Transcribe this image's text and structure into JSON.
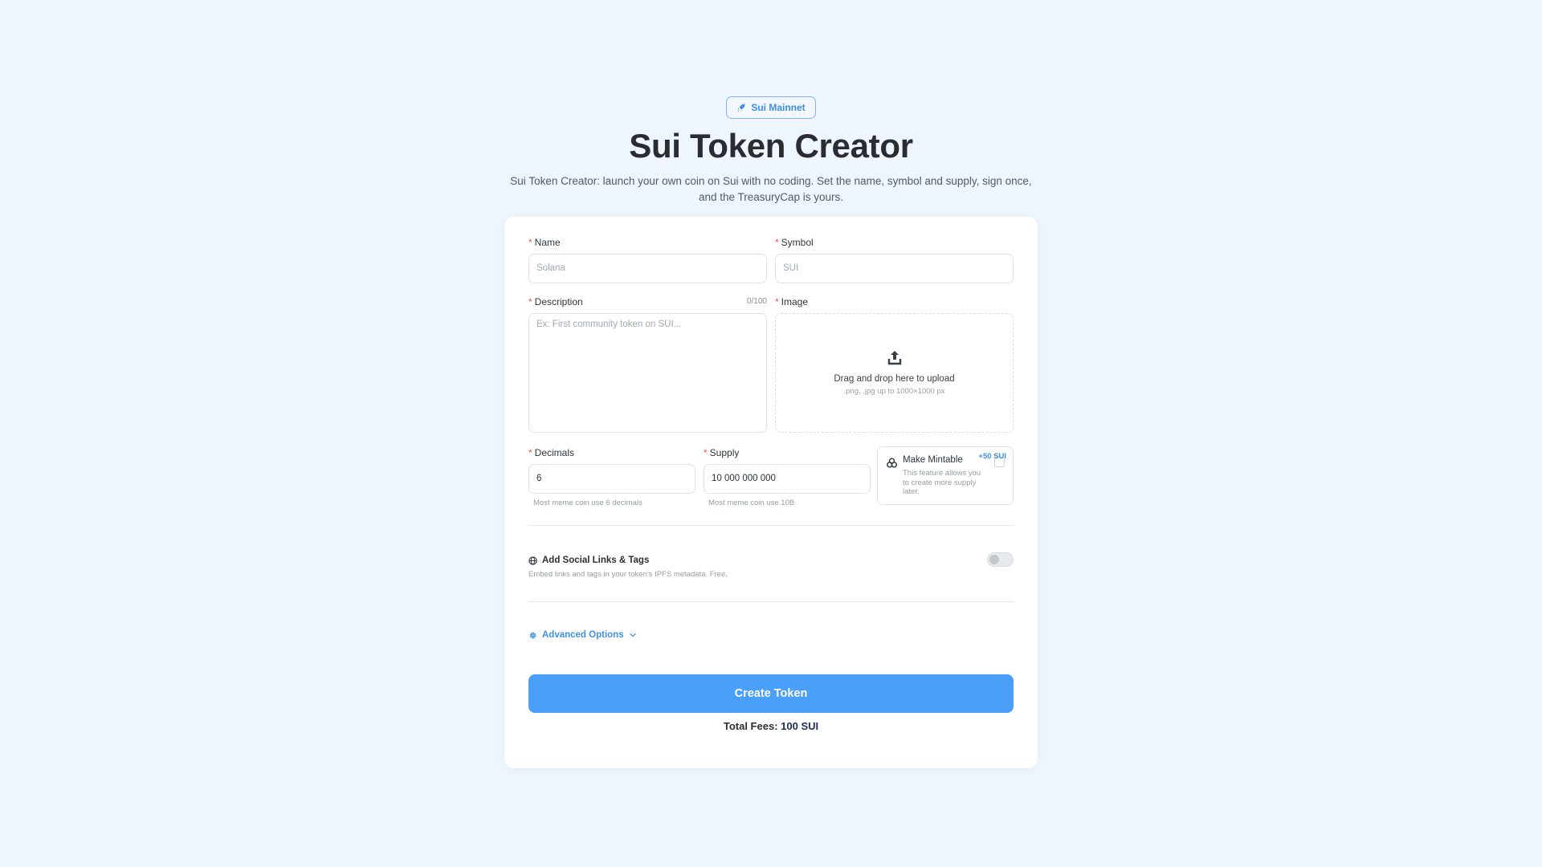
{
  "header": {
    "network_badge": "Sui Mainnet",
    "title": "Sui Token Creator",
    "subtitle": "Sui Token Creator: launch your own coin on Sui with no coding. Set the name, symbol and supply, sign once, and the TreasuryCap is yours."
  },
  "form": {
    "name": {
      "label": "Name",
      "placeholder": "Solana"
    },
    "symbol": {
      "label": "Symbol",
      "placeholder": "SUI"
    },
    "description": {
      "label": "Description",
      "counter": "0/100",
      "placeholder": "Ex: First community token on SUI..."
    },
    "image": {
      "label": "Image",
      "drop_text": "Drag and drop here to upload",
      "hint": ".png, .jpg up to 1000×1000 px"
    },
    "decimals": {
      "label": "Decimals",
      "value": "6",
      "help": "Most meme coin use 6 decimals"
    },
    "supply": {
      "label": "Supply",
      "value": "10 000 000 000",
      "help": "Most meme coin use 10B"
    },
    "mintable": {
      "title": "Make Mintable",
      "fee": "+50 SUI",
      "description": "This feature allows you to create more supply later.",
      "checked": false
    },
    "social": {
      "title": "Add Social Links & Tags",
      "description": "Embed links and tags in your token's IPFS metadata. Free.",
      "enabled": false
    },
    "advanced_label": "Advanced Options",
    "create_label": "Create Token",
    "fees_label": "Total Fees:",
    "fees_amount": "100 SUI"
  },
  "colors": {
    "accent": "#4a9ffa",
    "link": "#3f8fe0",
    "required": "#e0564f",
    "background": "#eef5fd"
  }
}
